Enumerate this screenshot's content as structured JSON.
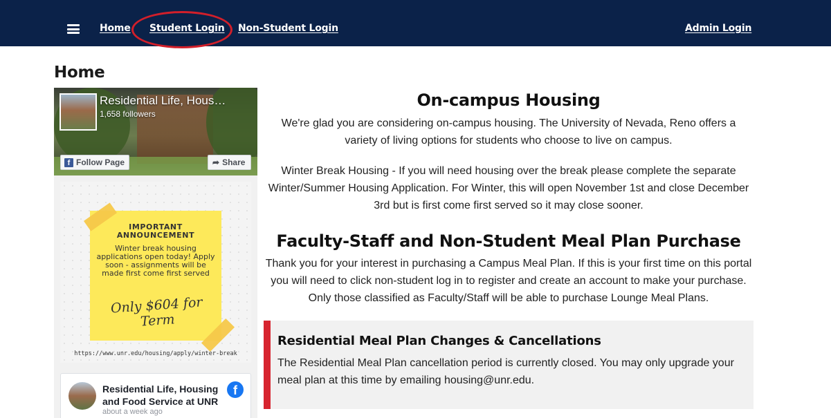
{
  "nav": {
    "menu_icon": "hamburger-menu-icon",
    "home": "Home",
    "student_login": "Student Login",
    "non_student_login": "Non-Student Login",
    "admin_login": "Admin Login",
    "background_color": "#0b2249",
    "highlight_color": "#d21f2a"
  },
  "page_title": "Home",
  "facebook_widget": {
    "page_name": "Residential Life, Hous…",
    "followers": "1,658 followers",
    "follow_label": "Follow Page",
    "share_label": "Share",
    "announcement": {
      "title_line1": "IMPORTANT",
      "title_line2": "ANNOUNCEMENT",
      "body": "Winter break housing applications open today! Apply soon - assignments will be made first come first served",
      "script_text": "Only $604 for Term",
      "url": "https://www.unr.edu/housing/apply/winter-break"
    },
    "feed_post": {
      "author": "Residential Life, Housing and Food Service at UNR",
      "time": "about a week ago"
    }
  },
  "main": {
    "housing_heading": "On-campus Housing",
    "housing_intro": "We're glad you are considering on-campus housing. The University of Nevada, Reno offers a variety of living options for students who choose to live on campus.",
    "winter_break": "Winter Break Housing - If you will need housing over the break please complete the separate Winter/Summer Housing Application. For Winter, this will open November 1st and close December 3rd but is first come first served so it may close sooner.",
    "meal_heading": "Faculty-Staff and Non-Student Meal Plan Purchase",
    "meal_text": "Thank you for your interest in purchasing a Campus Meal Plan. If this is your first time on this portal you will need to click non-student log in to register and create an account to make your purchase. Only those classified as Faculty/Staff will be able to purchase Lounge Meal Plans.",
    "notice": {
      "title": "Residential Meal Plan Changes & Cancellations",
      "body": "The Residential Meal Plan cancellation period is currently closed. You may only upgrade your meal plan at this time by emailing housing@unr.edu.",
      "accent_color": "#d7242f"
    }
  }
}
